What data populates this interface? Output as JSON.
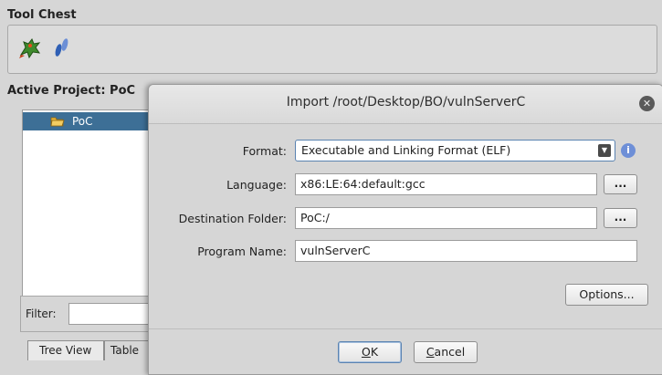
{
  "tool_chest": {
    "title": "Tool Chest",
    "tools": [
      {
        "name": "dragon-icon"
      },
      {
        "name": "footprints-icon"
      }
    ]
  },
  "project": {
    "title": "Active Project: PoC",
    "tree": [
      {
        "label": "PoC",
        "icon": "folder-icon",
        "selected": true
      }
    ],
    "filter_label": "Filter:",
    "filter_value": "",
    "tabs": [
      "Tree View",
      "Table"
    ]
  },
  "dialog": {
    "title": "Import /root/Desktop/BO/vulnServerC",
    "fields": {
      "format_label": "Format:",
      "format_value": "Executable and Linking Format (ELF)",
      "language_label": "Language:",
      "language_value": "x86:LE:64:default:gcc",
      "destination_label": "Destination Folder:",
      "destination_value": "PoC:/",
      "program_label": "Program Name:",
      "program_value": "vulnServerC"
    },
    "browse_label": "...",
    "options_label": "Options...",
    "ok_mnemonic": "O",
    "ok_rest": "K",
    "cancel_mnemonic": "C",
    "cancel_rest": "ancel",
    "colors": {
      "accent": "#3d6f96",
      "info": "#6e8fd7"
    }
  }
}
